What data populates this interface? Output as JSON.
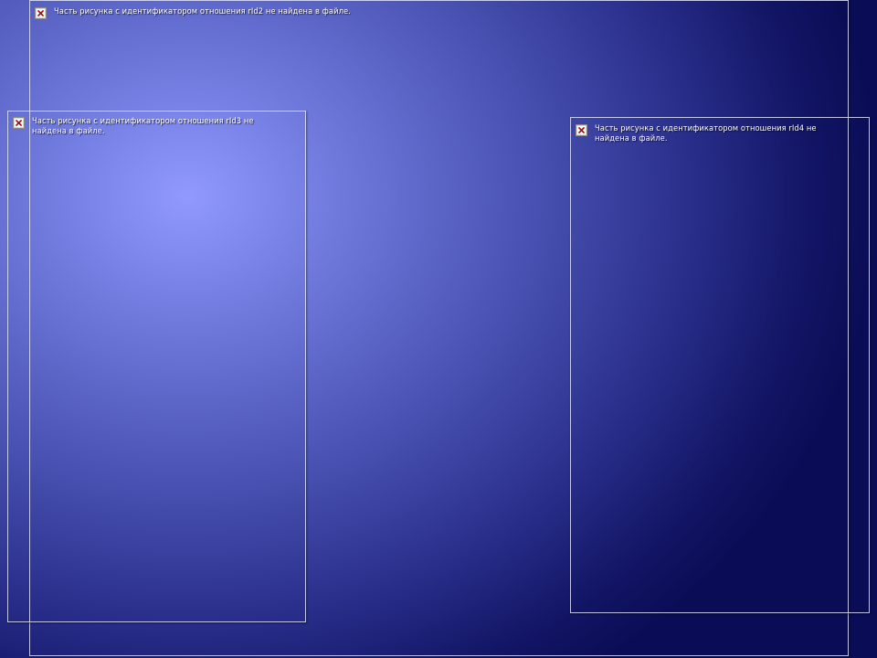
{
  "slide": {
    "placeholders": [
      {
        "id": "top",
        "message": "Часть рисунка с идентификатором отношения rId2 не найдена в файле.",
        "icon": "broken-image-icon"
      },
      {
        "id": "left",
        "message": "Часть рисунка с идентификатором отношения rId3 не найдена в файле.",
        "icon": "broken-image-icon"
      },
      {
        "id": "right",
        "message": "Часть рисунка с идентификатором отношения rId4 не найдена в файле.",
        "icon": "broken-image-icon"
      }
    ]
  },
  "colors": {
    "background_center": "#9199ff",
    "background_edge": "#0a0c55",
    "frame_border": "#e1e4ff",
    "icon_x": "#c00000",
    "text": "#ffffff"
  }
}
